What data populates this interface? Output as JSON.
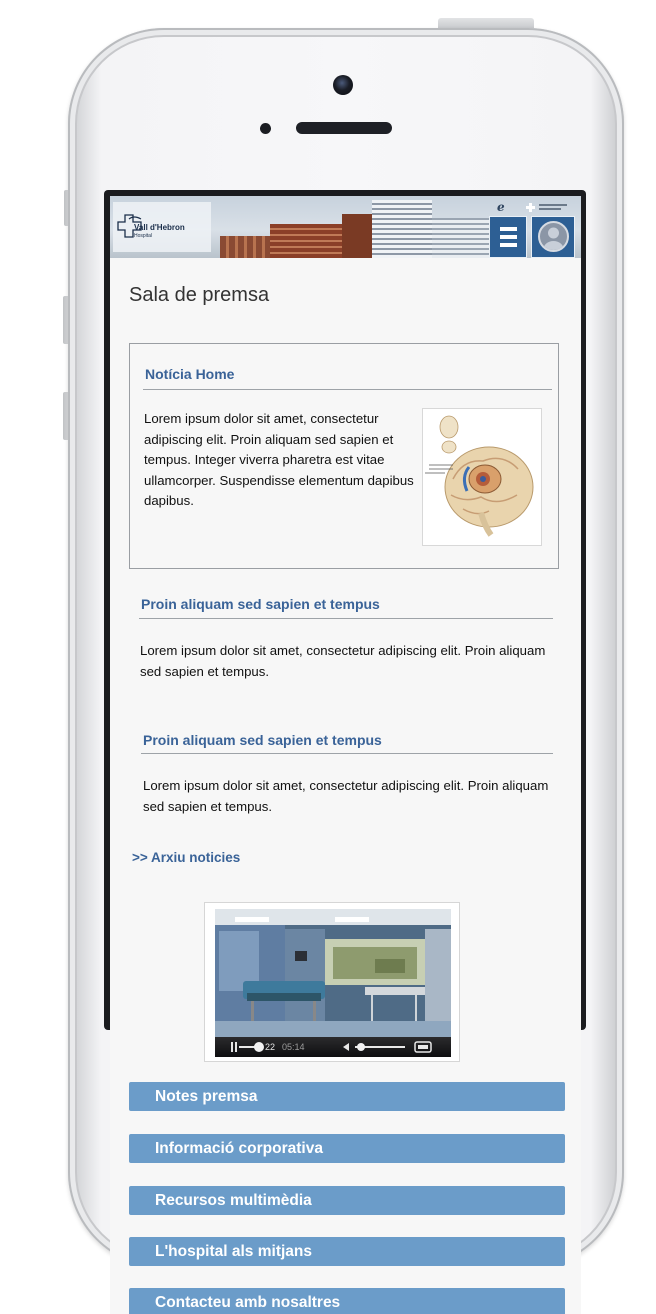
{
  "header": {
    "logo_name": "Vall d'Hebron",
    "logo_sub": "Hospital",
    "menu_icon": "hamburger-icon",
    "user_icon": "user-avatar-icon"
  },
  "page": {
    "title": "Sala de premsa"
  },
  "featured": {
    "title": "Notícia Home",
    "text": "Lorem ipsum dolor sit amet, consectetur adipiscing elit. Proin aliquam sed sapien et tempus. Integer viverra pharetra est vitae ullamcorper. Suspendisse elementum dapibus dapibus.",
    "image_icon": "brain-illustration"
  },
  "news": [
    {
      "title": "Proin aliquam sed sapien et tempus",
      "text": "Lorem ipsum dolor sit amet, consectetur adipiscing elit. Proin aliquam sed sapien et tempus."
    },
    {
      "title": "Proin aliquam sed sapien et tempus",
      "text": "Lorem ipsum dolor sit amet, consectetur adipiscing elit. Proin aliquam sed sapien et tempus."
    }
  ],
  "archive_link": ">> Arxiu noticies",
  "video": {
    "current_time": "22",
    "duration": "05:14",
    "controls": [
      "pause-icon",
      "volume-icon",
      "fullscreen-icon"
    ]
  },
  "nav": [
    {
      "label": "Notes premsa"
    },
    {
      "label": "Informació corporativa"
    },
    {
      "label": "Recursos multimèdia"
    },
    {
      "label": "L'hospital als mitjans"
    },
    {
      "label": "Contacteu amb nosaltres"
    }
  ],
  "colors": {
    "accent_blue": "#3a6398",
    "nav_button": "#6b9cc9",
    "header_button": "#2d5f94"
  }
}
